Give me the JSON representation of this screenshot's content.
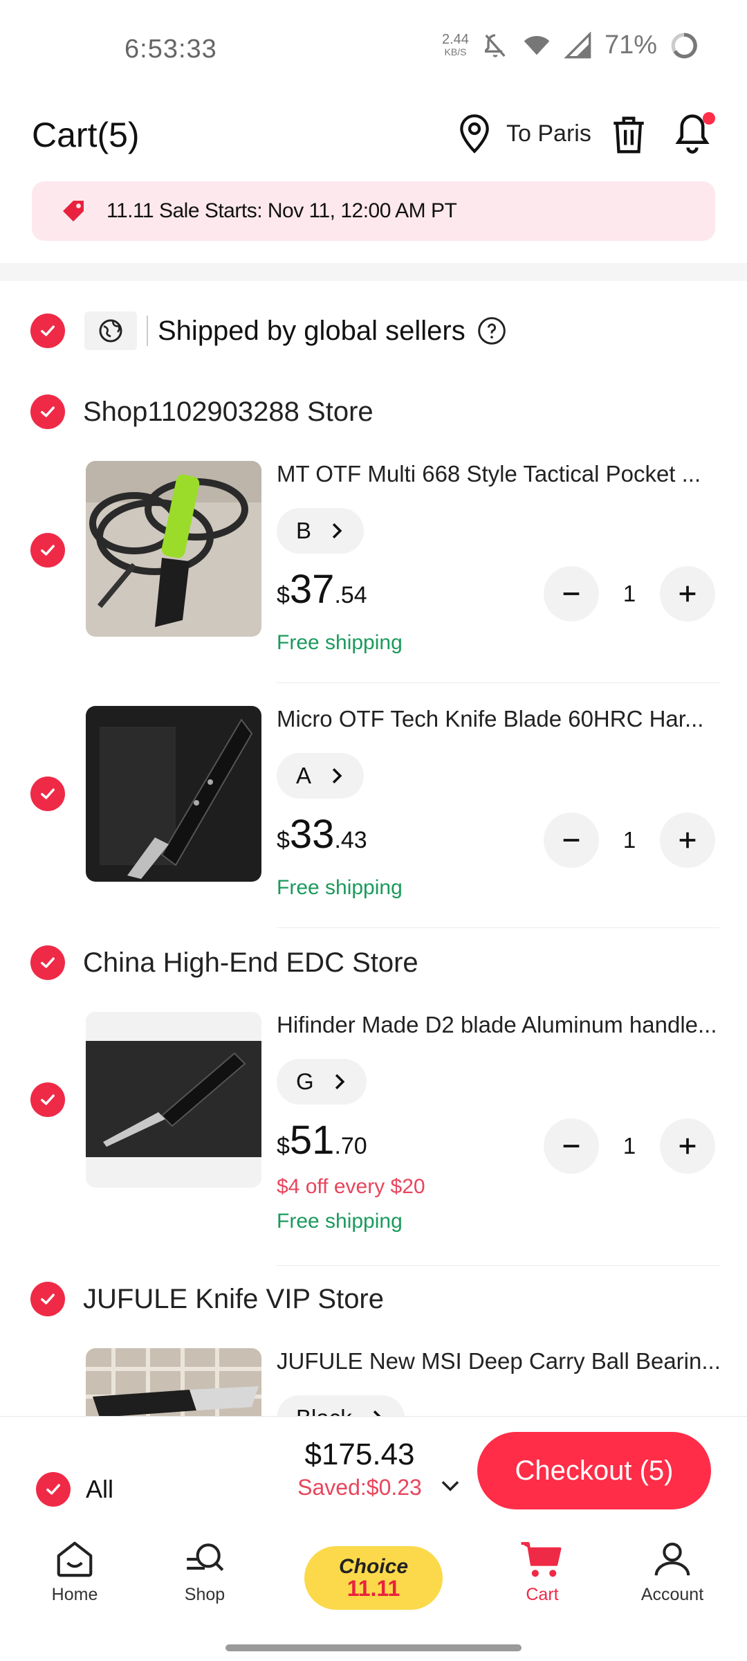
{
  "status_bar": {
    "time": "6:53:33",
    "net_speed": "2.44",
    "net_unit": "KB/S",
    "battery": "71%"
  },
  "header": {
    "title": "Cart(5)",
    "location": "To Paris"
  },
  "banner": {
    "text": "11.11 Sale Starts: Nov 11, 12:00 AM PT"
  },
  "global": {
    "label": "Shipped by global sellers"
  },
  "stores": [
    {
      "name": "Shop1102903288 Store",
      "items": [
        {
          "title": "MT OTF Multi 668 Style Tactical Pocket ...",
          "variant": "B",
          "currency": "$",
          "price_int": "37",
          "price_dec": ".54",
          "shipping": "Free shipping",
          "qty": "1"
        },
        {
          "title": "Micro OTF Tech Knife Blade 60HRC Har...",
          "variant": "A",
          "currency": "$",
          "price_int": "33",
          "price_dec": ".43",
          "shipping": "Free shipping",
          "qty": "1"
        }
      ]
    },
    {
      "name": "China High-End EDC Store",
      "items": [
        {
          "title": "Hifinder Made D2 blade Aluminum handle...",
          "variant": "G",
          "currency": "$",
          "price_int": "51",
          "price_dec": ".70",
          "promo": "$4 off every $20",
          "shipping": "Free shipping",
          "qty": "1"
        }
      ]
    },
    {
      "name": "JUFULE Knife VIP Store",
      "items": [
        {
          "title": "JUFULE New MSI Deep Carry Ball Bearin...",
          "variant": "Black"
        }
      ]
    }
  ],
  "checkout": {
    "all_label": "All",
    "total": "$175.43",
    "saved": "Saved:$0.23",
    "button": "Checkout (5)"
  },
  "nav": {
    "home": "Home",
    "shop": "Shop",
    "choice_top": "Choice",
    "choice_bottom": "11.11",
    "cart": "Cart",
    "account": "Account"
  },
  "colors": {
    "accent": "#ef2a46",
    "checkout": "#ff2d48",
    "shipping": "#1a9a5c",
    "promo": "#e8455c",
    "banner_bg": "#fde8ed",
    "choice_bg": "#fbd94a"
  },
  "icons": {
    "location": "map-pin-icon",
    "trash": "trash-icon",
    "bell": "bell-icon",
    "tag": "price-tag-icon",
    "globe": "globe-icon",
    "help": "question-circle-icon"
  }
}
